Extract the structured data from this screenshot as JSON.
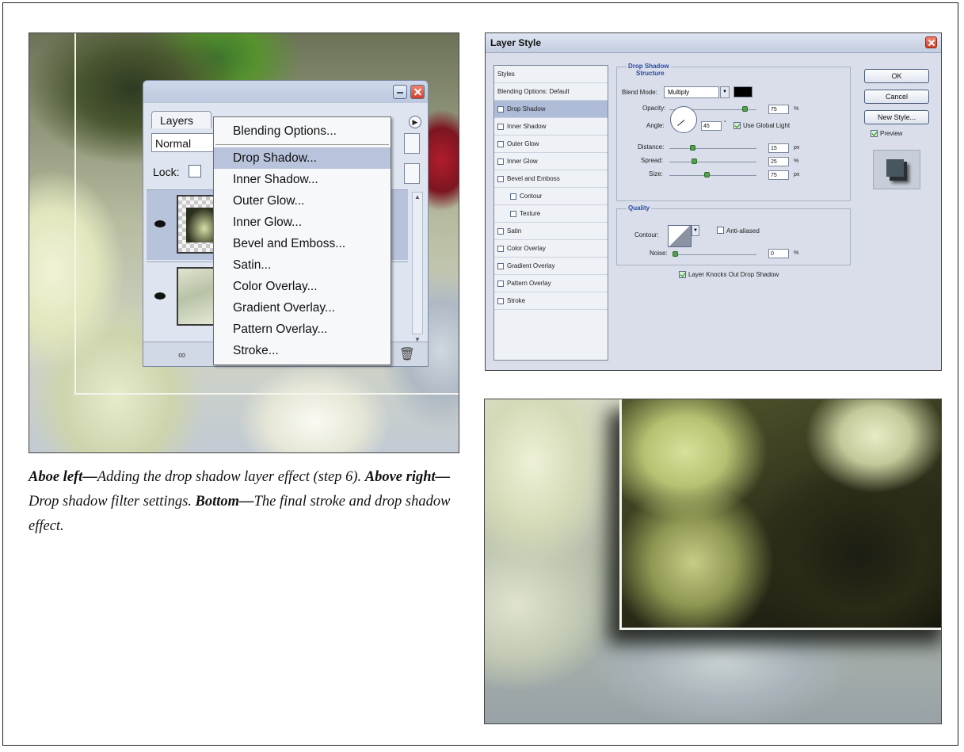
{
  "layers_panel": {
    "tab_label": "Layers",
    "blend_mode": "Normal",
    "lock_label": "Lock:"
  },
  "context_menu": {
    "items": [
      "Blending Options...",
      "Drop Shadow...",
      "Inner Shadow...",
      "Outer Glow...",
      "Inner Glow...",
      "Bevel and Emboss...",
      "Satin...",
      "Color Overlay...",
      "Gradient Overlay...",
      "Pattern Overlay...",
      "Stroke..."
    ],
    "highlighted": "Drop Shadow..."
  },
  "caption": {
    "part1_bold": "Aboe left—",
    "part1_text": "Adding the drop shadow layer effect (step 6). ",
    "part2_bold": "Above right—",
    "part2_text": "Drop shadow filter settings. ",
    "part3_bold": "Bottom—",
    "part3_text": "The final stroke and drop shadow effect."
  },
  "layer_style_dialog": {
    "title": "Layer Style",
    "styles": [
      "Styles",
      "Blending Options: Default",
      "Drop Shadow",
      "Inner Shadow",
      "Outer Glow",
      "Inner Glow",
      "Bevel and Emboss",
      "Contour",
      "Texture",
      "Satin",
      "Color Overlay",
      "Gradient Overlay",
      "Pattern Overlay",
      "Stroke"
    ],
    "drop_shadow_title": "Drop Shadow",
    "structure_title": "Structure",
    "blend_mode_label": "Blend Mode:",
    "blend_mode_value": "Multiply",
    "opacity_label": "Opacity:",
    "opacity_value": "75",
    "angle_label": "Angle:",
    "angle_value": "45",
    "use_global_light": "Use Global Light",
    "distance_label": "Distance:",
    "distance_value": "15",
    "spread_label": "Spread:",
    "spread_value": "25",
    "size_label": "Size:",
    "size_value": "75",
    "px_unit": "px",
    "pct_unit": "%",
    "deg_unit": "°",
    "quality_title": "Quality",
    "contour_label": "Contour:",
    "anti_aliased": "Anti-aliased",
    "noise_label": "Noise:",
    "noise_value": "0",
    "knock_out": "Layer Knocks Out Drop Shadow",
    "ok_label": "OK",
    "cancel_label": "Cancel",
    "new_style_label": "New Style...",
    "preview_label": "Preview"
  }
}
